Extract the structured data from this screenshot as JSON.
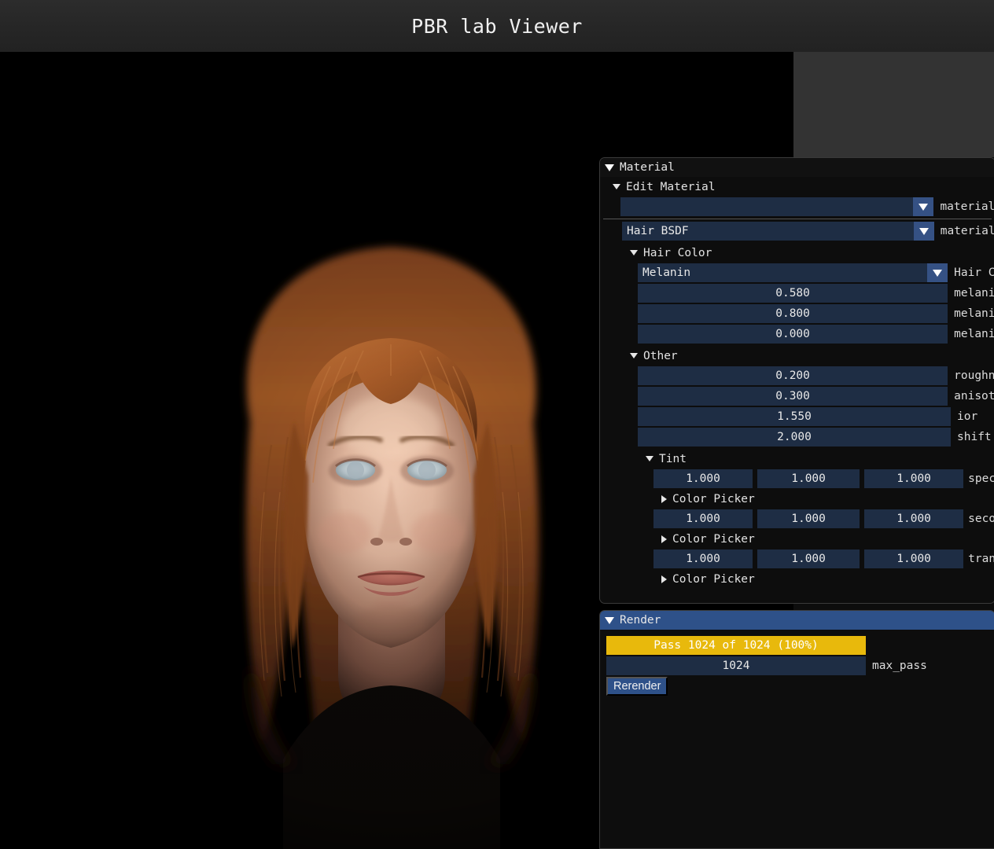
{
  "window": {
    "title": "PBR lab Viewer"
  },
  "viewport": {
    "name": "render-viewport",
    "description": "Ray-traced 3D render of a female head with long auburn hair on a black background"
  },
  "material_panel": {
    "header": {
      "label": "Material",
      "expanded": true,
      "icon": "triangle-down-icon"
    },
    "edit_material": {
      "label": "Edit Material",
      "expanded": true,
      "icon": "triangle-down-icon"
    },
    "material_select": {
      "value": "",
      "label": "material",
      "icon": "chevron-down-icon"
    },
    "bsdf_select": {
      "value": "Hair BSDF",
      "label": "material",
      "icon": "chevron-down-icon"
    },
    "hair_color": {
      "label": "Hair Color",
      "expanded": true,
      "mode_select": {
        "value": "Melanin",
        "label": "Hair C",
        "icon": "chevron-down-icon"
      },
      "fields": [
        {
          "value": "0.580",
          "label": "melani"
        },
        {
          "value": "0.800",
          "label": "melani"
        },
        {
          "value": "0.000",
          "label": "melani"
        }
      ]
    },
    "other": {
      "label": "Other",
      "expanded": true,
      "fields": [
        {
          "value": "0.200",
          "label": "roughn"
        },
        {
          "value": "0.300",
          "label": "anisot"
        },
        {
          "value": "1.550",
          "label": "ior"
        },
        {
          "value": "2.000",
          "label": "shift"
        }
      ]
    },
    "tint": {
      "label": "Tint",
      "expanded": true,
      "groups": [
        {
          "rgb": [
            "1.000",
            "1.000",
            "1.000"
          ],
          "label": "spec",
          "picker": {
            "label": "Color Picker",
            "expanded": false,
            "icon": "triangle-right-icon"
          }
        },
        {
          "rgb": [
            "1.000",
            "1.000",
            "1.000"
          ],
          "label": "seco",
          "picker": {
            "label": "Color Picker",
            "expanded": false,
            "icon": "triangle-right-icon"
          }
        },
        {
          "rgb": [
            "1.000",
            "1.000",
            "1.000"
          ],
          "label": "tran",
          "picker": {
            "label": "Color Picker",
            "expanded": false,
            "icon": "triangle-right-icon"
          }
        }
      ]
    }
  },
  "render_panel": {
    "header": {
      "label": "Render",
      "expanded": true,
      "icon": "triangle-down-icon"
    },
    "progress": {
      "text": "Pass 1024 of 1024 (100%)",
      "percent": 100,
      "color": "#e8b90c"
    },
    "max_pass": {
      "value": "1024",
      "label": "max_pass"
    },
    "rerender_button": {
      "label": "Rerender"
    }
  },
  "colors": {
    "title_bar": "#262626",
    "viewport_bg": "#000000",
    "panel_bg": "#0d0d0d",
    "field_bg": "#1e2d44",
    "accent_blue": "#2e5189",
    "combo_arrow": "#355184",
    "progress_gold": "#e8b90c",
    "gray_pane": "#333333"
  }
}
